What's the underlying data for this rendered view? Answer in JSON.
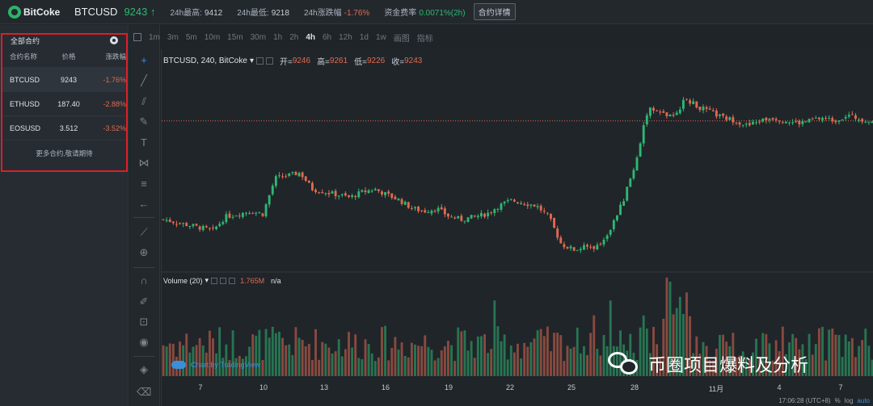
{
  "header": {
    "brand": "BitCoke",
    "symbol": "BTCUSD",
    "last_price": "9243",
    "high_label": "24h最高:",
    "high_value": "9412",
    "low_label": "24h最低:",
    "low_value": "9218",
    "change_label": "24h涨跌幅",
    "change_value": "-1.76%",
    "funding_label": "资金费率",
    "funding_value": "0.0071%(2h)",
    "detail_button": "合约详情"
  },
  "sidebar": {
    "title": "全部合约",
    "columns": [
      "合约名称",
      "价格",
      "涨跌幅"
    ],
    "rows": [
      {
        "name": "BTCUSD",
        "price": "9243",
        "change": "-1.76%"
      },
      {
        "name": "ETHUSD",
        "price": "187.40",
        "change": "-2.88%"
      },
      {
        "name": "EOSUSD",
        "price": "3.512",
        "change": "-3.52%"
      }
    ],
    "more": "更多合约,敬请期待"
  },
  "timeframes": [
    "1m",
    "3m",
    "5m",
    "10m",
    "15m",
    "30m",
    "1h",
    "2h",
    "4h",
    "6h",
    "12h",
    "1d",
    "1w",
    "画图",
    "指标"
  ],
  "active_timeframe": "4h",
  "legend": {
    "title": "BTCUSD, 240, BitCoke",
    "open_label": "开=",
    "open": "9246",
    "high_label": "高=",
    "high": "9261",
    "low_label": "低=",
    "low": "9226",
    "close_label": "收=",
    "close": "9243"
  },
  "volume_legend": {
    "title": "Volume (20)",
    "value": "1.765M",
    "na": "n/a"
  },
  "x_axis_labels": [
    "7",
    "10",
    "13",
    "16",
    "19",
    "22",
    "25",
    "28",
    "11月",
    "4",
    "7"
  ],
  "status": {
    "time": "17:06:28 (UTC+8)",
    "percent": "%",
    "log": "log",
    "auto": "auto"
  },
  "tradingview": "Chart by TradingView",
  "watermark": "币圈项目爆料及分析",
  "colors": {
    "up": "#2eb872",
    "down": "#e06a50",
    "accent": "#3a8fd8",
    "highlight_box": "#d8202a"
  },
  "chart_data": {
    "type": "candlestick",
    "interval": "4h",
    "symbol": "BTCUSD",
    "x_axis_labels": [
      "7",
      "10",
      "13",
      "16",
      "19",
      "22",
      "25",
      "28",
      "11月",
      "4",
      "7"
    ],
    "approx_close_path": [
      7450,
      7400,
      7350,
      7300,
      7250,
      7500,
      7550,
      7600,
      7550,
      8200,
      8250,
      8300,
      8000,
      7950,
      7900,
      7850,
      7950,
      8000,
      7900,
      7800,
      7650,
      7600,
      7650,
      7500,
      7450,
      7500,
      7550,
      7700,
      7800,
      7750,
      7700,
      7500,
      7000,
      6900,
      6950,
      6950,
      7300,
      7800,
      8500,
      9500,
      9400,
      9300,
      9650,
      9500,
      9400,
      9300,
      9250,
      9150,
      9250,
      9300,
      9250,
      9200,
      9250,
      9300,
      9250,
      9350,
      9280,
      9243
    ],
    "last_price": 9243
  }
}
